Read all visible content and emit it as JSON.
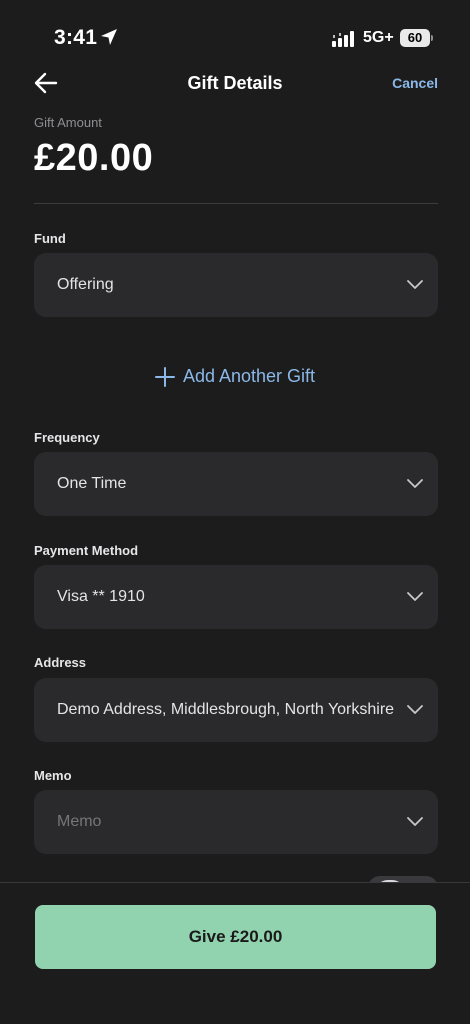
{
  "status_bar": {
    "time": "3:41",
    "network": "5G+",
    "battery": "60"
  },
  "nav": {
    "title": "Gift Details",
    "cancel_label": "Cancel"
  },
  "amount": {
    "label": "Gift Amount",
    "value": "£20.00"
  },
  "fund": {
    "label": "Fund",
    "value": "Offering"
  },
  "add_gift_label": "Add Another Gift",
  "frequency": {
    "label": "Frequency",
    "value": "One Time"
  },
  "payment_method": {
    "label": "Payment Method",
    "value": "Visa ** 1910"
  },
  "address": {
    "label": "Address",
    "value": "Demo Address, Middlesbrough, North Yorkshire"
  },
  "memo": {
    "label": "Memo",
    "placeholder": "Memo"
  },
  "give_button_label": "Give £20.00",
  "colors": {
    "background": "#1c1c1d",
    "field": "#2a2a2c",
    "accent_link": "#8bb8e8",
    "give_button": "#92d3af"
  },
  "icons": [
    "location-arrow-icon",
    "signal-icon",
    "battery-icon",
    "back-arrow-icon",
    "chevron-down-icon",
    "plus-icon"
  ]
}
